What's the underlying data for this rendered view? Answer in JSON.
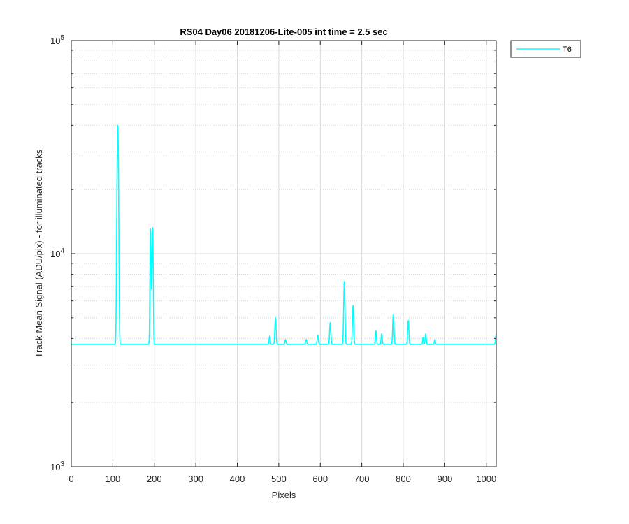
{
  "chart_data": {
    "type": "line",
    "title": "RS04 Day06 20181206-Lite-005 int time = 2.5 sec",
    "xlabel": "Pixels",
    "ylabel": "Track Mean Signal (ADU/pix) - for illuminated tracks",
    "xlim": [
      0,
      1024
    ],
    "ylim": [
      1000,
      100000
    ],
    "yscale": "log",
    "grid": true,
    "minor_grid_y": true,
    "legend_position": "outside-top-right",
    "x_ticks": [
      0,
      100,
      200,
      300,
      400,
      500,
      600,
      700,
      800,
      900,
      1000
    ],
    "x_tick_labels": [
      "0",
      "100",
      "200",
      "300",
      "400",
      "500",
      "600",
      "700",
      "800",
      "900",
      "1000"
    ],
    "y_ticks": [
      1000,
      10000,
      100000
    ],
    "y_tick_labels": [
      {
        "base": "10",
        "exp": "3"
      },
      {
        "base": "10",
        "exp": "4"
      },
      {
        "base": "10",
        "exp": "5"
      }
    ],
    "baseline": 3750,
    "series": [
      {
        "name": "T6",
        "color": "#00ffff",
        "peaks": [
          {
            "x": 112,
            "y": 40000,
            "width": 1.6
          },
          {
            "x": 191,
            "y": 13000,
            "width": 1.2
          },
          {
            "x": 196,
            "y": 13200,
            "width": 1.2
          },
          {
            "x": 193.5,
            "y": 4700,
            "width": 1.0
          },
          {
            "x": 478,
            "y": 4100,
            "width": 1.2
          },
          {
            "x": 492,
            "y": 5000,
            "width": 1.4
          },
          {
            "x": 516,
            "y": 3950,
            "width": 1.3
          },
          {
            "x": 566,
            "y": 3950,
            "width": 1.3
          },
          {
            "x": 594,
            "y": 4150,
            "width": 1.3
          },
          {
            "x": 624,
            "y": 4750,
            "width": 1.4
          },
          {
            "x": 658,
            "y": 7400,
            "width": 1.4
          },
          {
            "x": 679,
            "y": 5700,
            "width": 1.4
          },
          {
            "x": 734,
            "y": 4350,
            "width": 1.3
          },
          {
            "x": 748,
            "y": 4200,
            "width": 1.3
          },
          {
            "x": 776,
            "y": 5200,
            "width": 1.4
          },
          {
            "x": 812,
            "y": 4850,
            "width": 1.4
          },
          {
            "x": 848,
            "y": 4050,
            "width": 1.2
          },
          {
            "x": 854,
            "y": 4200,
            "width": 1.2
          },
          {
            "x": 876,
            "y": 3950,
            "width": 1.2
          },
          {
            "x": 1024,
            "y": 4200,
            "width": 1.5
          }
        ]
      }
    ]
  }
}
